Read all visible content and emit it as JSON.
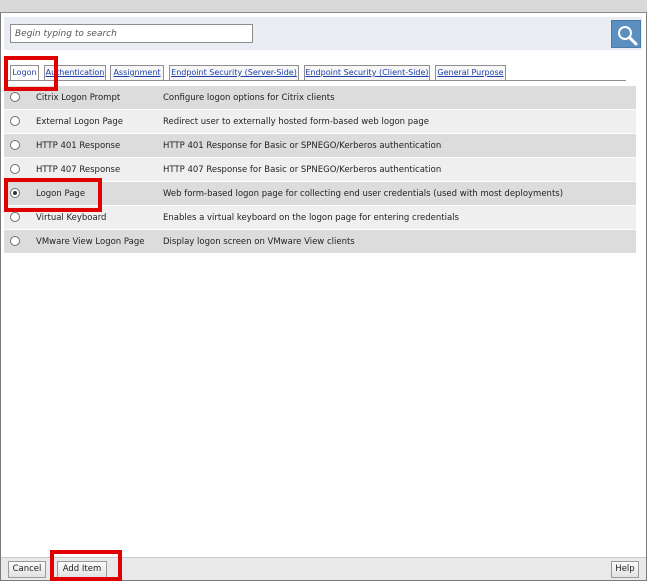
{
  "search": {
    "placeholder": "Begin typing to search"
  },
  "tabs": [
    {
      "label": "Logon",
      "active": true
    },
    {
      "label": "Authentication",
      "active": false
    },
    {
      "label": "Assignment",
      "active": false
    },
    {
      "label": "Endpoint Security (Server-Side)",
      "active": false
    },
    {
      "label": "Endpoint Security (Client-Side)",
      "active": false
    },
    {
      "label": "General Purpose",
      "active": false
    }
  ],
  "items": [
    {
      "name": "Citrix Logon Prompt",
      "description": "Configure logon options for Citrix clients",
      "selected": false
    },
    {
      "name": "External Logon Page",
      "description": "Redirect user to externally hosted form-based web logon page",
      "selected": false
    },
    {
      "name": "HTTP 401 Response",
      "description": "HTTP 401 Response for Basic or SPNEGO/Kerberos authentication",
      "selected": false
    },
    {
      "name": "HTTP 407 Response",
      "description": "HTTP 407 Response for Basic or SPNEGO/Kerberos authentication",
      "selected": false
    },
    {
      "name": "Logon Page",
      "description": "Web form-based logon page for collecting end user credentials (used with most deployments)",
      "selected": true
    },
    {
      "name": "Virtual Keyboard",
      "description": "Enables a virtual keyboard on the logon page for entering credentials",
      "selected": false
    },
    {
      "name": "VMware View Logon Page",
      "description": "Display logon screen on VMware View clients",
      "selected": false
    }
  ],
  "footer": {
    "cancel_label": "Cancel",
    "add_label": "Add Item",
    "help_label": "Help"
  },
  "colors": {
    "highlight": "#e00000",
    "search_button": "#5b8fbf",
    "link": "#1d3fa8"
  },
  "icons": {
    "search": "magnifier-icon"
  }
}
